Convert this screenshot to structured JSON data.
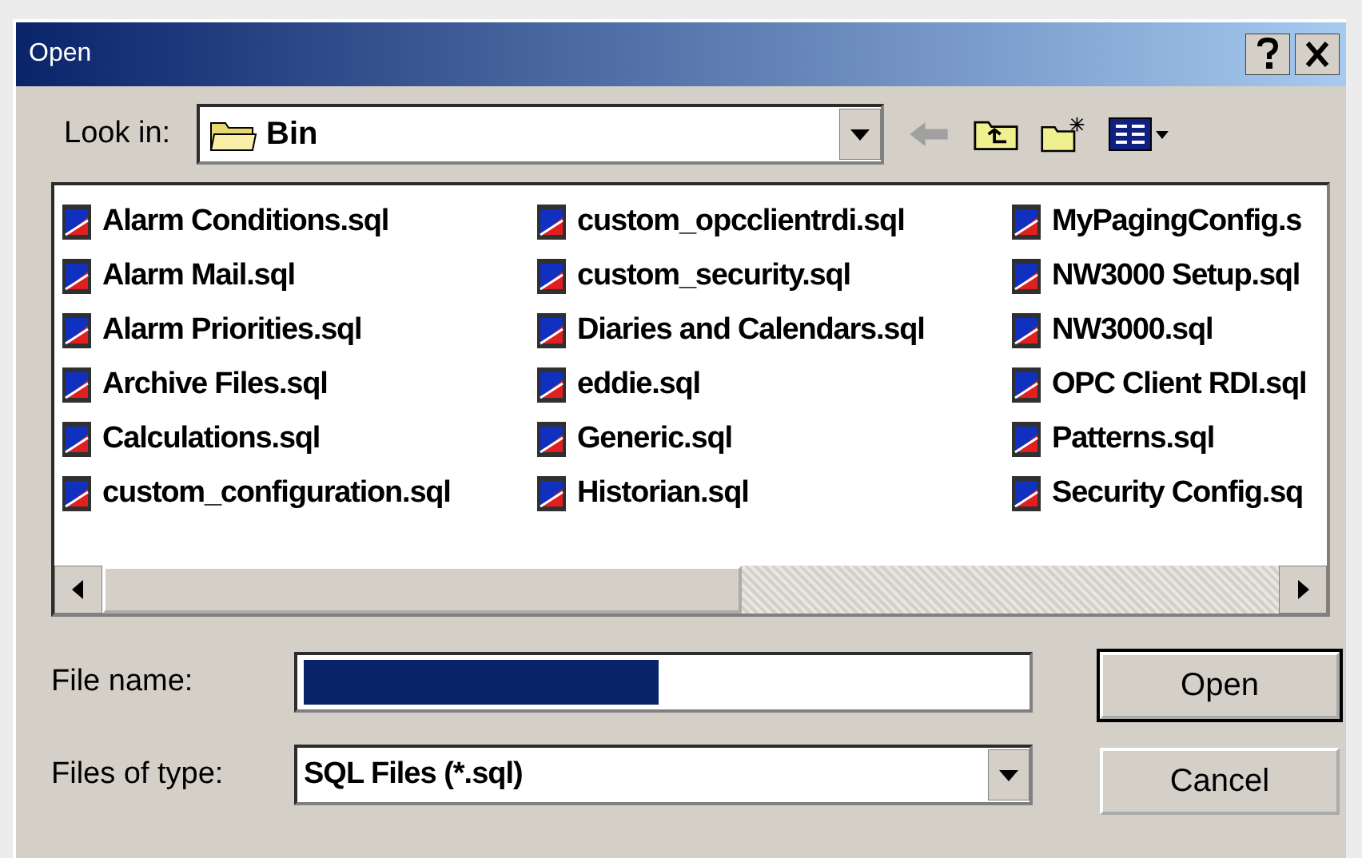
{
  "window": {
    "title": "Open"
  },
  "look_in": {
    "label": "Look in:",
    "value": "Bin"
  },
  "files": [
    {
      "name": "Alarm Conditions.sql"
    },
    {
      "name": "Alarm Mail.sql"
    },
    {
      "name": "Alarm Priorities.sql"
    },
    {
      "name": "Archive Files.sql"
    },
    {
      "name": "Calculations.sql"
    },
    {
      "name": "custom_configuration.sql"
    },
    {
      "name": "custom_opcclientrdi.sql"
    },
    {
      "name": "custom_security.sql"
    },
    {
      "name": "Diaries and Calendars.sql"
    },
    {
      "name": "eddie.sql"
    },
    {
      "name": "Generic.sql"
    },
    {
      "name": "Historian.sql"
    },
    {
      "name": "MyPagingConfig.s"
    },
    {
      "name": "NW3000 Setup.sql"
    },
    {
      "name": "NW3000.sql"
    },
    {
      "name": "OPC Client RDI.sql"
    },
    {
      "name": "Patterns.sql"
    },
    {
      "name": "Security Config.sq"
    }
  ],
  "file_name": {
    "label": "File name:",
    "text_selected": true
  },
  "file_type": {
    "label": "Files of type:",
    "value": "SQL Files (*.sql)"
  },
  "buttons": [
    {
      "label": "Open",
      "default": true
    },
    {
      "label": "Cancel",
      "default": false
    }
  ]
}
